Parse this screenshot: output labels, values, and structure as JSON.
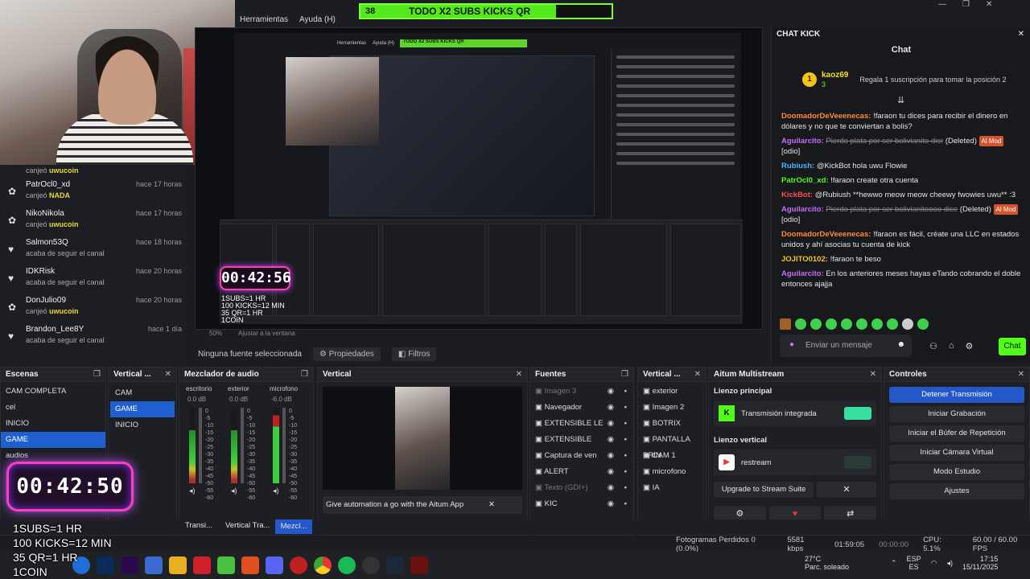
{
  "menubar": {
    "items": [
      "Herramientas",
      "Ayuda (H)"
    ]
  },
  "goal_bar": {
    "count": "38",
    "text": "TODO X2 SUBS KICKS QR",
    "progress": 0.78,
    "color": "#56e81f"
  },
  "activity": [
    {
      "icon": "gift-icon",
      "name": "PatrOcl0_xd",
      "time": "hace 17 horas",
      "sub_prefix": "canjeó",
      "sub_value": "NADA"
    },
    {
      "icon": "gift-icon",
      "name": "NikoNikola",
      "time": "hace 17 horas",
      "sub_prefix": "canjeó",
      "sub_value": "uwucoin"
    },
    {
      "icon": "heart-icon",
      "name": "Salmon53Q",
      "time": "hace 18 horas",
      "sub_prefix": "acaba de seguir el canal",
      "sub_value": ""
    },
    {
      "icon": "heart-icon",
      "name": "IDKRisk",
      "time": "hace 20 horas",
      "sub_prefix": "acaba de seguir el canal",
      "sub_value": ""
    },
    {
      "icon": "gift-icon",
      "name": "DonJulio09",
      "time": "hace 20 horas",
      "sub_prefix": "canjeó",
      "sub_value": "uwucoin"
    },
    {
      "icon": "heart-icon",
      "name": "Brandon_Lee8Y",
      "time": "hace 1 día",
      "sub_prefix": "acaba de seguir el canal",
      "sub_value": ""
    }
  ],
  "activity_top": {
    "sub_prefix": "canjeó",
    "sub_value": "uwucoin"
  },
  "preview": {
    "zoom": "50%",
    "fit": "Ajustar a la ventana",
    "no_source": "Ninguna fuente seleccionada",
    "properties": "Propiedades",
    "filters": "Filtros",
    "nested_timer": "00:42:56",
    "nested_goal": "TODO X2 SUBS KICKS QR",
    "nested_overlay": [
      "1SUBS=1 HR",
      "100 KICKS=12 MIN",
      "35 QR=1 HR",
      "1COIN"
    ]
  },
  "chat": {
    "header": "CHAT KICK",
    "title": "Chat",
    "pinned": {
      "user": "kaoz69",
      "count": "3",
      "gift_text": "Regala 1 suscripción para tomar la posición 2"
    },
    "messages": [
      {
        "user": "DoomadorDeVeeenecas:",
        "color": "#ff8a3a",
        "text": "!faraon tu dices para recibir el dinero en dólares y no que te conviertan a bolis?",
        "deleted": false,
        "tag": ""
      },
      {
        "user": "Aguilarcito:",
        "color": "#c66cff",
        "text": "Pierdo plata por ser bolivianito dicr",
        "deleted": true,
        "tag": "Al Mod",
        "extra": "(Deleted)",
        "tail": "[odio]"
      },
      {
        "user": "Rubiush:",
        "color": "#4fb2ff",
        "text": "@KickBot hola uwu Flowie",
        "deleted": false,
        "tag": ""
      },
      {
        "user": "PatrOcl0_xd:",
        "color": "#53fc18",
        "text": "!faraon create otra cuenta",
        "deleted": false,
        "tag": ""
      },
      {
        "user": "KickBot:",
        "color": "#ff4d4d",
        "text": "@Rubiush **hewwo meow meow cheewy fwowies uwu** :3",
        "deleted": false,
        "tag": ""
      },
      {
        "user": "Aguilarcito:",
        "color": "#c66cff",
        "text": "Pierdo plata por ser bolivianitoooo dice",
        "deleted": true,
        "tag": "Al Mod",
        "extra": "(Deleted)",
        "tail": "[odio]"
      },
      {
        "user": "DoomadorDeVeeenecas:",
        "color": "#ff8a3a",
        "text": "!faraon es fácil, créate una LLC en estados unidos y ahí asocias tu cuenta de kick",
        "deleted": false,
        "tag": ""
      },
      {
        "user": "JOJITO0102:",
        "color": "#f2c230",
        "text": "!faraon te beso",
        "deleted": false,
        "tag": ""
      },
      {
        "user": "Aguilarcito:",
        "color": "#c66cff",
        "text": "En los anteriores meses hayas eTando cobrando el doble entonces ajajja",
        "deleted": false,
        "tag": ""
      }
    ],
    "input_placeholder": "Enviar un mensaje",
    "send": "Chat"
  },
  "docks": {
    "scenes": {
      "title": "Escenas",
      "items": [
        "CAM COMPLETA",
        "cel",
        "INICIO",
        "GAME",
        "audios"
      ],
      "selected": 3
    },
    "vertical_scenes": {
      "title": "Vertical ...",
      "items": [
        "CAM",
        "GAME",
        "INICIO"
      ],
      "selected": 1
    },
    "mixer": {
      "title": "Mezclador de audio",
      "channels": [
        {
          "name": "escritorio",
          "db": "0.0 dB"
        },
        {
          "name": "exterior",
          "db": "0.0 dB"
        },
        {
          "name": "microfono",
          "db": "-6.0 dB"
        }
      ],
      "scale": [
        "0",
        "-5",
        "-10",
        "-15",
        "-20",
        "-25",
        "-30",
        "-35",
        "-40",
        "-45",
        "-50",
        "-55",
        "-60"
      ]
    },
    "vertical": {
      "title": "Vertical",
      "banner": "Give automation a go with the Aitum App"
    },
    "sources": {
      "title": "Fuentes",
      "items": [
        {
          "name": "Imagen 3",
          "dim": true
        },
        {
          "name": "Navegador",
          "dim": false
        },
        {
          "name": "EXTENSIBLE LE",
          "dim": false
        },
        {
          "name": "EXTENSIBLE",
          "dim": false
        },
        {
          "name": "Captura de ven",
          "dim": false
        },
        {
          "name": "ALERT",
          "dim": false
        },
        {
          "name": "Texto (GDI+)",
          "dim": true
        },
        {
          "name": "KIC",
          "dim": false
        }
      ]
    },
    "vertical_sources": {
      "title": "Vertical ...",
      "items": [
        "exterior",
        "Imagen 2",
        "BOTRIX",
        "PANTALLA PRIN",
        "CAM 1",
        "microfono",
        "IA"
      ]
    },
    "aitum": {
      "title": "Aitum Multistream",
      "main_canvas": "Lienzo principal",
      "main_stream": "Transmisión integrada",
      "vertical_canvas": "Lienzo vertical",
      "vertical_stream": "restream",
      "upgrade": "Upgrade to Stream Suite"
    },
    "controls": {
      "title": "Controles",
      "buttons": [
        "Detener Transmisión",
        "Iniciar Grabación",
        "Iniciar el Búfer de Repetición",
        "Iniciar Cámara Virtual",
        "Modo Estudio",
        "Ajustes"
      ]
    }
  },
  "bottom_tabs": [
    "Transi...",
    "Vertical Tra...",
    "Mezcl..."
  ],
  "timer": "00:42:50",
  "overlay_lines": [
    "1SUBS=1 HR",
    "100 KICKS=12 MIN",
    "35 QR=1 HR",
    "1COIN"
  ],
  "status": {
    "dropped": "Fotogramas Perdidos 0 (0.0%)",
    "kbps": "5581 kbps",
    "live_time": "01:59:05",
    "rec_time": "00:00:00",
    "cpu": "CPU: 5.1%",
    "fps": "60.00 / 60.00 FPS"
  },
  "tray": {
    "temp": "27°C",
    "weather": "Parc. soleado",
    "lang1": "ESP",
    "lang2": "ES",
    "time": "17:15",
    "date": "15/11/2025"
  }
}
